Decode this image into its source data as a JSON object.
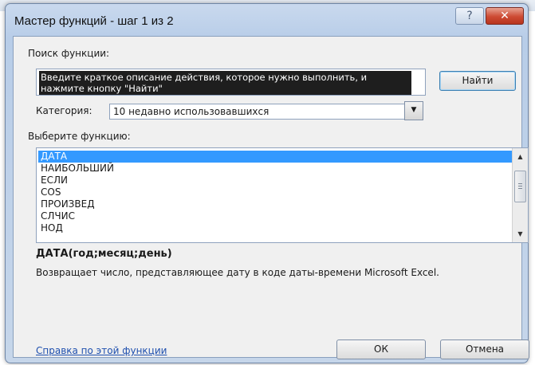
{
  "dialog": {
    "title": "Мастер функций - шаг 1 из 2",
    "help_icon": "question-mark-icon",
    "close_icon": "close-x-icon"
  },
  "search": {
    "label": "Поиск функции:",
    "value": "Введите краткое описание действия, которое нужно выполнить, и нажмите кнопку \"Найти\"",
    "find_button": "Найти"
  },
  "category": {
    "label": "Категория:",
    "selected": "10 недавно использовавшихся"
  },
  "functions": {
    "label": "Выберите функцию:",
    "items": [
      "ДАТА",
      "НАИБОЛЬШИЙ",
      "ЕСЛИ",
      "COS",
      "ПРОИЗВЕД",
      "СЛЧИС",
      "НОД"
    ],
    "selected_index": 0
  },
  "details": {
    "signature": "ДАТА(год;месяц;день)",
    "description": "Возвращает число, представляющее дату в коде даты-времени Microsoft Excel."
  },
  "footer": {
    "help_link": "Справка по этой функции",
    "ok": "ОК",
    "cancel": "Отмена"
  },
  "colors": {
    "selection": "#3399ff",
    "link": "#1e4fae",
    "close_button": "#cd4a33"
  }
}
